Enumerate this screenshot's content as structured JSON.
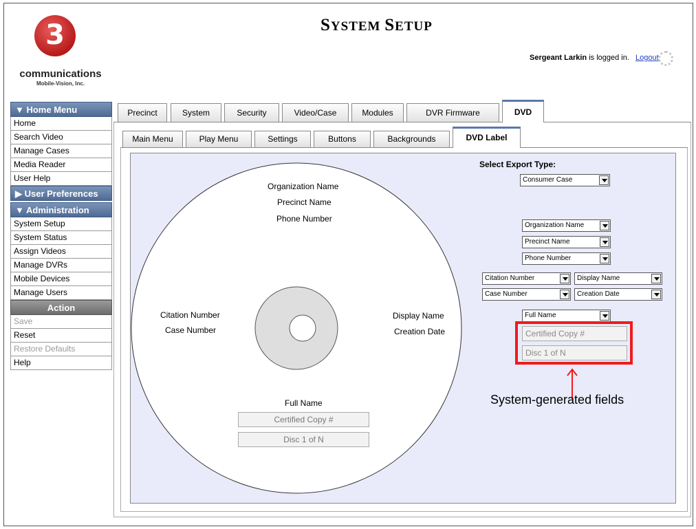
{
  "header": {
    "title_caps": [
      "S",
      "YSTEM ",
      "S",
      "ETUP"
    ],
    "logo_mark": "3",
    "logo_text": "communications",
    "logo_sub": "Mobile-Vision, Inc.",
    "user": "Sergeant Larkin",
    "login_suffix": "is logged in.",
    "logout": "Logout"
  },
  "sidebar": {
    "home_menu": {
      "title": "▼ Home Menu",
      "items": [
        "Home",
        "Search Video",
        "Manage Cases",
        "Media Reader",
        "User Help"
      ]
    },
    "user_prefs": {
      "title": "▶ User Preferences"
    },
    "admin": {
      "title": "▼ Administration",
      "items": [
        "System Setup",
        "System Status",
        "Assign Videos",
        "Manage DVRs",
        "Mobile Devices",
        "Manage Users"
      ]
    },
    "action": {
      "title": "Action",
      "items": [
        "Save",
        "Reset",
        "Restore Defaults",
        "Help"
      ]
    }
  },
  "tabs_main": [
    "Precinct",
    "System",
    "Security",
    "Video/Case",
    "Modules",
    "DVR Firmware",
    "DVD"
  ],
  "tabs_sub": [
    "Main Menu",
    "Play Menu",
    "Settings",
    "Buttons",
    "Backgrounds",
    "DVD Label"
  ],
  "disc": {
    "org": "Organization Name",
    "precinct": "Precinct Name",
    "phone": "Phone Number",
    "citation": "Citation Number",
    "case": "Case Number",
    "display": "Display Name",
    "creation": "Creation Date",
    "full_name": "Full Name",
    "certified": "Certified Copy #",
    "disc_n": "Disc 1 of N"
  },
  "controls": {
    "export_label": "Select Export Type:",
    "export_type": "Consumer Case",
    "org": "Organization Name",
    "precinct": "Precinct Name",
    "phone": "Phone Number",
    "left1": "Citation Number",
    "right1": "Display Name",
    "left2": "Case Number",
    "right2": "Creation Date",
    "full_name": "Full Name",
    "certified": "Certified Copy #",
    "disc_n": "Disc 1 of N"
  },
  "callout": "System-generated fields",
  "colors": {
    "accent": "#4f6b95",
    "highlight": "#ee1c1c",
    "label_bg": "#e9ebfa"
  }
}
